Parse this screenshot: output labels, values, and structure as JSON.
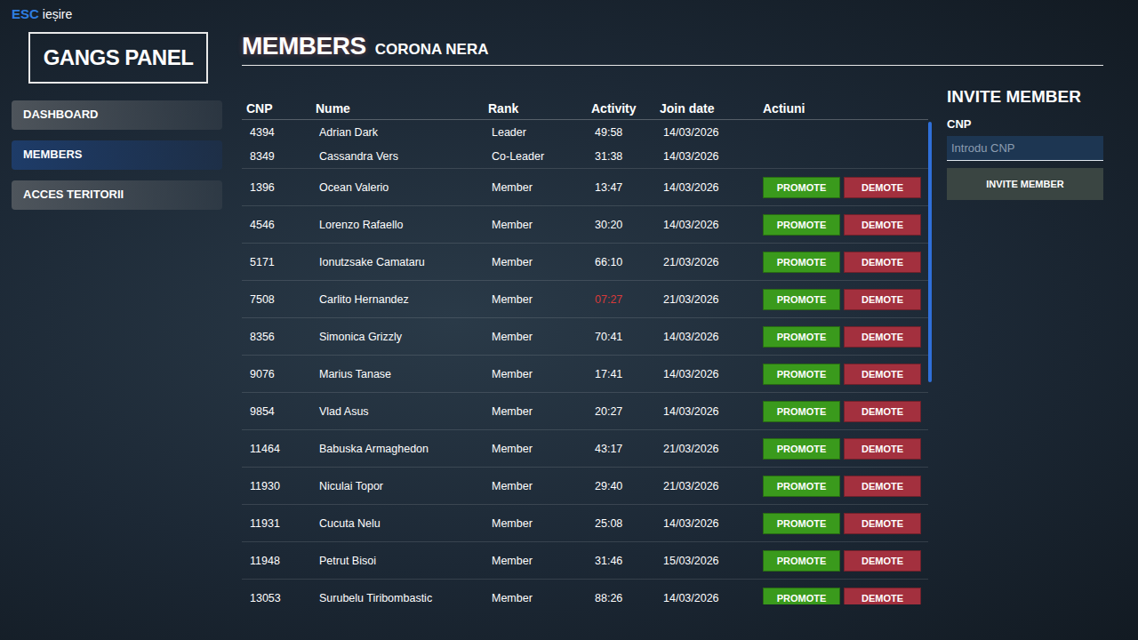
{
  "exit": {
    "key": "ESC",
    "label": "ieșire"
  },
  "panel_title": "GANGS PANEL",
  "sidebar": {
    "items": [
      {
        "label": "DASHBOARD",
        "selected": false
      },
      {
        "label": "MEMBERS",
        "selected": true
      },
      {
        "label": "ACCES TERITORII",
        "selected": false
      }
    ]
  },
  "page": {
    "title": "MEMBERS",
    "subtitle": "CORONA NERA"
  },
  "table": {
    "columns": [
      "CNP",
      "Nume",
      "Rank",
      "Activity",
      "Join date",
      "Actiuni"
    ],
    "action_buttons": [
      {
        "label": "PROMOTE",
        "kind": "promote"
      },
      {
        "label": "DEMOTE",
        "kind": "demote"
      }
    ],
    "scrollbar": {
      "level": 0.54
    },
    "rows": [
      {
        "cnp": "4394",
        "name": "Adrian Dark",
        "rank": "Leader",
        "activity": "49:58",
        "low_activity": false,
        "join_date": "14/03/2026",
        "actions": false
      },
      {
        "cnp": "8349",
        "name": "Cassandra Vers",
        "rank": "Co-Leader",
        "activity": "31:38",
        "low_activity": false,
        "join_date": "14/03/2026",
        "actions": false
      },
      {
        "cnp": "1396",
        "name": "Ocean Valerio",
        "rank": "Member",
        "activity": "13:47",
        "low_activity": false,
        "join_date": "14/03/2026",
        "actions": true
      },
      {
        "cnp": "4546",
        "name": "Lorenzo Rafaello",
        "rank": "Member",
        "activity": "30:20",
        "low_activity": false,
        "join_date": "14/03/2026",
        "actions": true
      },
      {
        "cnp": "5171",
        "name": "Ionutzsake Camataru",
        "rank": "Member",
        "activity": "66:10",
        "low_activity": false,
        "join_date": "21/03/2026",
        "actions": true
      },
      {
        "cnp": "7508",
        "name": "Carlito Hernandez",
        "rank": "Member",
        "activity": "07:27",
        "low_activity": true,
        "join_date": "21/03/2026",
        "actions": true
      },
      {
        "cnp": "8356",
        "name": "Simonica Grizzly",
        "rank": "Member",
        "activity": "70:41",
        "low_activity": false,
        "join_date": "14/03/2026",
        "actions": true
      },
      {
        "cnp": "9076",
        "name": "Marius Tanase",
        "rank": "Member",
        "activity": "17:41",
        "low_activity": false,
        "join_date": "14/03/2026",
        "actions": true
      },
      {
        "cnp": "9854",
        "name": "Vlad Asus",
        "rank": "Member",
        "activity": "20:27",
        "low_activity": false,
        "join_date": "14/03/2026",
        "actions": true
      },
      {
        "cnp": "11464",
        "name": "Babuska Armaghedon",
        "rank": "Member",
        "activity": "43:17",
        "low_activity": false,
        "join_date": "21/03/2026",
        "actions": true
      },
      {
        "cnp": "11930",
        "name": "Niculai Topor",
        "rank": "Member",
        "activity": "29:40",
        "low_activity": false,
        "join_date": "21/03/2026",
        "actions": true
      },
      {
        "cnp": "11931",
        "name": "Cucuta Nelu",
        "rank": "Member",
        "activity": "25:08",
        "low_activity": false,
        "join_date": "14/03/2026",
        "actions": true
      },
      {
        "cnp": "11948",
        "name": "Petrut Bisoi",
        "rank": "Member",
        "activity": "31:46",
        "low_activity": false,
        "join_date": "15/03/2026",
        "actions": true
      },
      {
        "cnp": "13053",
        "name": "Surubelu Tiribombastic",
        "rank": "Member",
        "activity": "88:26",
        "low_activity": false,
        "join_date": "14/03/2026",
        "actions": true
      }
    ]
  },
  "invite": {
    "title": "INVITE MEMBER",
    "field_label": "CNP",
    "placeholder": "Introdu CNP",
    "button": "INVITE MEMBER"
  }
}
